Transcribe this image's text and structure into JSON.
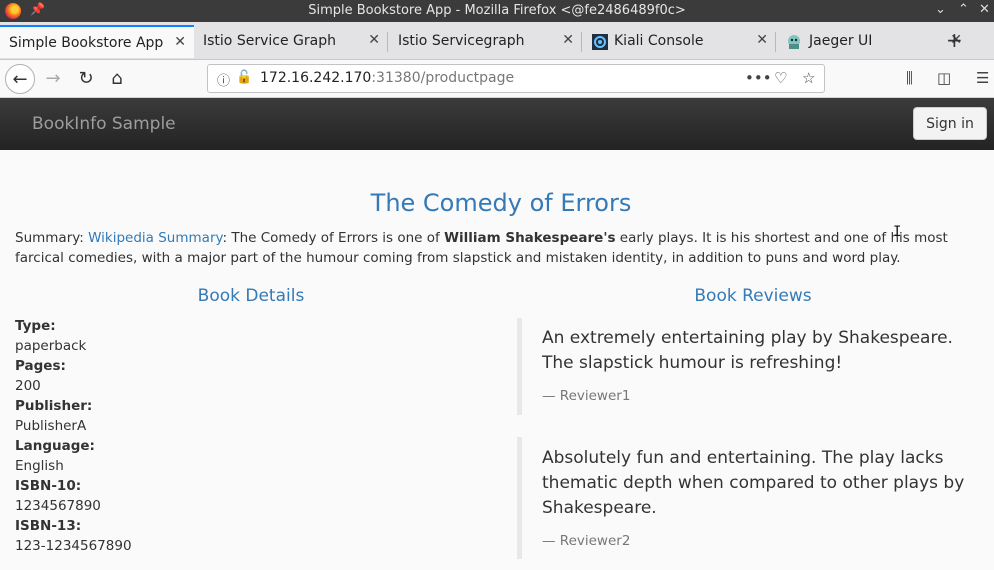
{
  "window": {
    "title": "Simple Bookstore App - Mozilla Firefox <@fe2486489f0c>",
    "controls": [
      "⌄",
      "⌃",
      "✕"
    ]
  },
  "tabs": [
    {
      "label": "Simple Bookstore App",
      "active": true
    },
    {
      "label": "Istio Service Graph",
      "active": false
    },
    {
      "label": "Istio Servicegraph",
      "active": false
    },
    {
      "label": "Kiali Console",
      "active": false
    },
    {
      "label": "Jaeger UI",
      "active": false
    }
  ],
  "nav": {
    "url_host": "172.16.242.170",
    "url_rest": ":31380/productpage"
  },
  "page": {
    "brand": "BookInfo Sample",
    "signin_label": "Sign in",
    "title": "The Comedy of Errors",
    "summary": {
      "prefix": "Summary: ",
      "link": "Wikipedia Summary",
      "text1": ": The Comedy of Errors is one of ",
      "bold": "William Shakespeare's",
      "text2": " early plays. It is his shortest and one of his most farcical comedies, with a major part of the humour coming from slapstick and mistaken identity, in addition to puns and word play."
    },
    "details_title": "Book Details",
    "reviews_title": "Book Reviews",
    "details": [
      {
        "key": "Type:",
        "value": "paperback"
      },
      {
        "key": "Pages:",
        "value": "200"
      },
      {
        "key": "Publisher:",
        "value": "PublisherA"
      },
      {
        "key": "Language:",
        "value": "English"
      },
      {
        "key": "ISBN-10:",
        "value": "1234567890"
      },
      {
        "key": "ISBN-13:",
        "value": "123-1234567890"
      }
    ],
    "reviews": [
      {
        "text": "An extremely entertaining play by Shakespeare. The slapstick humour is refreshing!",
        "reviewer": "— Reviewer1"
      },
      {
        "text": "Absolutely fun and entertaining. The play lacks thematic depth when compared to other plays by Shakespeare.",
        "reviewer": "— Reviewer2"
      }
    ]
  }
}
